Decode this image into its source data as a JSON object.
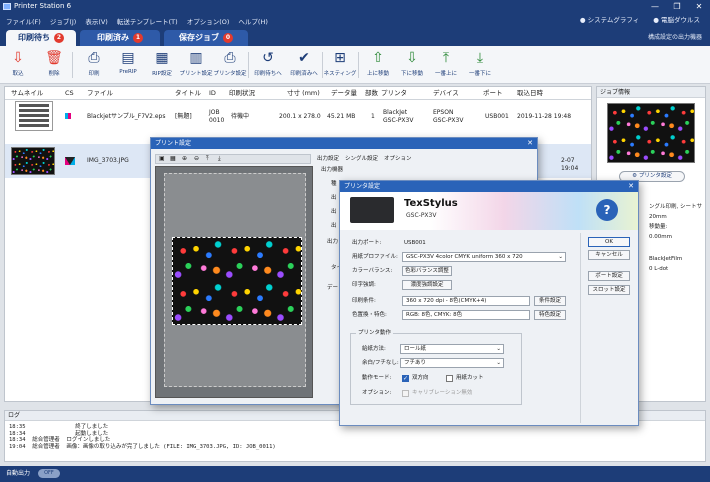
{
  "window": {
    "title": "Printer Station 6",
    "controls": [
      "—",
      "❐",
      "✕"
    ]
  },
  "menu": {
    "items": [
      "ファイル(F)",
      "ジョブ(J)",
      "表示(V)",
      "転送テンプレート(T)",
      "オプション(O)",
      "ヘルプ(H)"
    ],
    "right": [
      "システムグラフィ",
      "電脳ダウルス"
    ]
  },
  "tabs": [
    {
      "label": "印刷待ち",
      "badge": "2"
    },
    {
      "label": "印刷済み",
      "badge": "1"
    },
    {
      "label": "保存ジョブ",
      "badge": "0"
    }
  ],
  "tab_hint": "構成設定の出力機器",
  "toolbar": [
    {
      "label": "取込",
      "icon": "import-icon"
    },
    {
      "label": "削除",
      "icon": "delete-icon"
    },
    {
      "label": "印刷",
      "icon": "print-icon"
    },
    {
      "label": "PreRIP",
      "icon": "prerip-icon"
    },
    {
      "label": "RIP設定",
      "icon": "rip-settings-icon"
    },
    {
      "label": "プリント設定",
      "icon": "print-settings-icon"
    },
    {
      "label": "プリンタ設定",
      "icon": "printer-settings-icon"
    },
    {
      "label": "印刷待ちへ",
      "icon": "move-to-queue-icon"
    },
    {
      "label": "印刷済みへ",
      "icon": "move-to-done-icon"
    },
    {
      "label": "ネスティング",
      "icon": "nesting-icon"
    },
    {
      "label": "上に移動",
      "icon": "move-up-icon"
    },
    {
      "label": "下に移動",
      "icon": "move-down-icon"
    },
    {
      "label": "一番上に",
      "icon": "move-top-icon"
    },
    {
      "label": "一番下に",
      "icon": "move-bottom-icon"
    }
  ],
  "job_list": {
    "columns": [
      "サムネイル",
      "CS",
      "ファイル",
      "タイトル",
      "ID",
      "印刷状況",
      "寸寸 (mm)",
      "データ量",
      "部数",
      "プリンタ",
      "デバイス",
      "ポート",
      "取込日時"
    ],
    "rows": [
      {
        "file": "Blackjetサンプル_F7V2.eps",
        "title": "[無題]",
        "id": "JOB\n0010",
        "status": "待機中",
        "size": "200.1 x 278.0",
        "data": "45.21 MB",
        "copies": "1",
        "printer": "BlackJet\nGSC-PX3V",
        "device": "EPSON\nGSC-PX3V",
        "port": "USB001",
        "date": "2019-11-28 19:48"
      },
      {
        "file": "IMG_3703.JPG",
        "title": "",
        "id": "",
        "status": "",
        "size": "",
        "data": "",
        "copies": "",
        "printer": "",
        "device": "",
        "port": "",
        "date": "2-07 19:04"
      }
    ]
  },
  "right_panel": {
    "title": "ジョブ情報",
    "printer_button": "プリンタ設定",
    "lines": [
      "ングル印刷, シートサ",
      "20mm",
      "移動量:",
      "0.00mm",
      "BlackJetFilm",
      "0 L-dot"
    ]
  },
  "log": {
    "title": "ログ",
    "lines": [
      {
        "time": "18:35",
        "user": "",
        "msg": "終了しました"
      },
      {
        "time": "18:34",
        "user": "",
        "msg": "起動しました"
      },
      {
        "time": "18:34",
        "user": "総合管理者",
        "msg": "ログインしました"
      },
      {
        "time": "19:04",
        "user": "総合管理者",
        "msg": "画像：画像の取り込みが完了しました (FILE: IMG_3703.JPG, ID: JOB_0011)"
      }
    ]
  },
  "status_bar": {
    "label": "自動出力",
    "toggle": "OFF"
  },
  "print_dialog": {
    "title": "プリント設定",
    "tabs": [
      "出力設定",
      "シングル設定",
      "オプション"
    ],
    "section": "出力機器",
    "row_labels": [
      "種",
      "出",
      "出",
      "出",
      "出力",
      "タイ",
      "デー"
    ]
  },
  "printer_dialog": {
    "title": "プリンタ設定",
    "brand": "TexStylus",
    "model": "GSC-PX3V",
    "fields": {
      "port_label": "出力ポート:",
      "port_value": "USB001",
      "profile_label": "用紙プロファイル:",
      "profile_value": "GSC-PX3V 4color CMYK uniform 360 x 720",
      "color_label": "カラーバランス:",
      "color_button": "色彩バランス調整",
      "density_label": "印字強調:",
      "density_button": "濃度強調設定",
      "cond_label": "印刷条件:",
      "cond_value": "360 x 720 dpi - 8色(CMYK+4)",
      "cond_button": "条件設定",
      "special_label": "色置換・特色:",
      "special_value": "RGB: 8色, CMYK: 8色",
      "special_button": "特色設定"
    },
    "group": {
      "title": "プリンタ動作",
      "feed_label": "給紙方法:",
      "feed_value": "ロール紙",
      "margin_label": "余白/フチなし:",
      "margin_value": "フチあり",
      "mode_label": "動作モード:",
      "bidir": "双方向",
      "cut": "用紙カット",
      "option_label": "オプション:",
      "option_value": "キャリブレーション無効"
    },
    "buttons": {
      "ok": "OK",
      "cancel": "キャンセル",
      "port": "ポート設定",
      "slot": "スロット設定"
    }
  }
}
